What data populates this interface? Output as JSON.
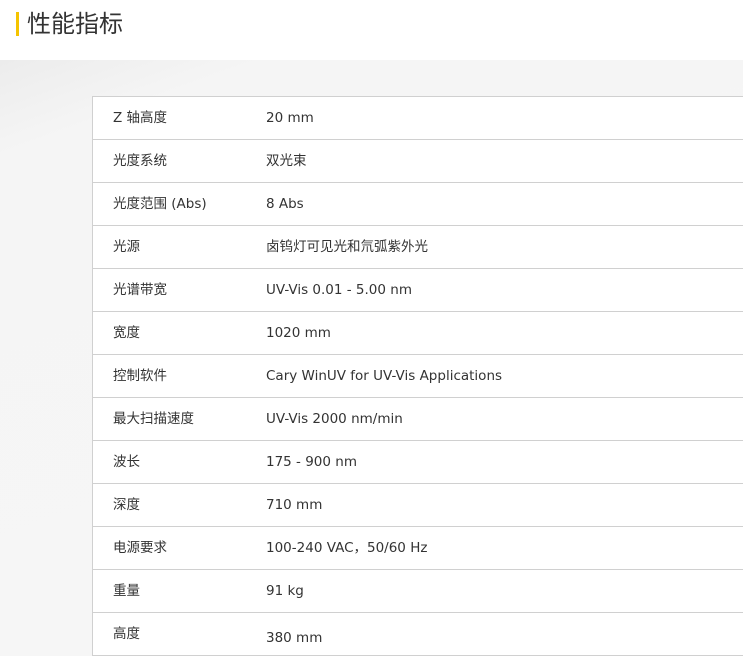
{
  "section": {
    "title": "性能指标",
    "accent_color": "#f5c400"
  },
  "specs": [
    {
      "label": "Z 轴高度",
      "value": "20 mm"
    },
    {
      "label": "光度系统",
      "value": "双光束"
    },
    {
      "label": "光度范围 (Abs)",
      "value": "8 Abs"
    },
    {
      "label": "光源",
      "value": "卤钨灯可见光和氘弧紫外光"
    },
    {
      "label": "光谱带宽",
      "value": "UV-Vis 0.01 - 5.00 nm"
    },
    {
      "label": "宽度",
      "value": "1020 mm"
    },
    {
      "label": "控制软件",
      "value": "Cary WinUV for UV-Vis Applications"
    },
    {
      "label": "最大扫描速度",
      "value": "UV-Vis 2000 nm/min"
    },
    {
      "label": "波长",
      "value": "175 - 900 nm"
    },
    {
      "label": "深度",
      "value": "710 mm"
    },
    {
      "label": "电源要求",
      "value": "100-240 VAC，50/60 Hz"
    },
    {
      "label": "重量",
      "value": "91 kg"
    },
    {
      "label": "高度",
      "value": "380 mm"
    }
  ]
}
